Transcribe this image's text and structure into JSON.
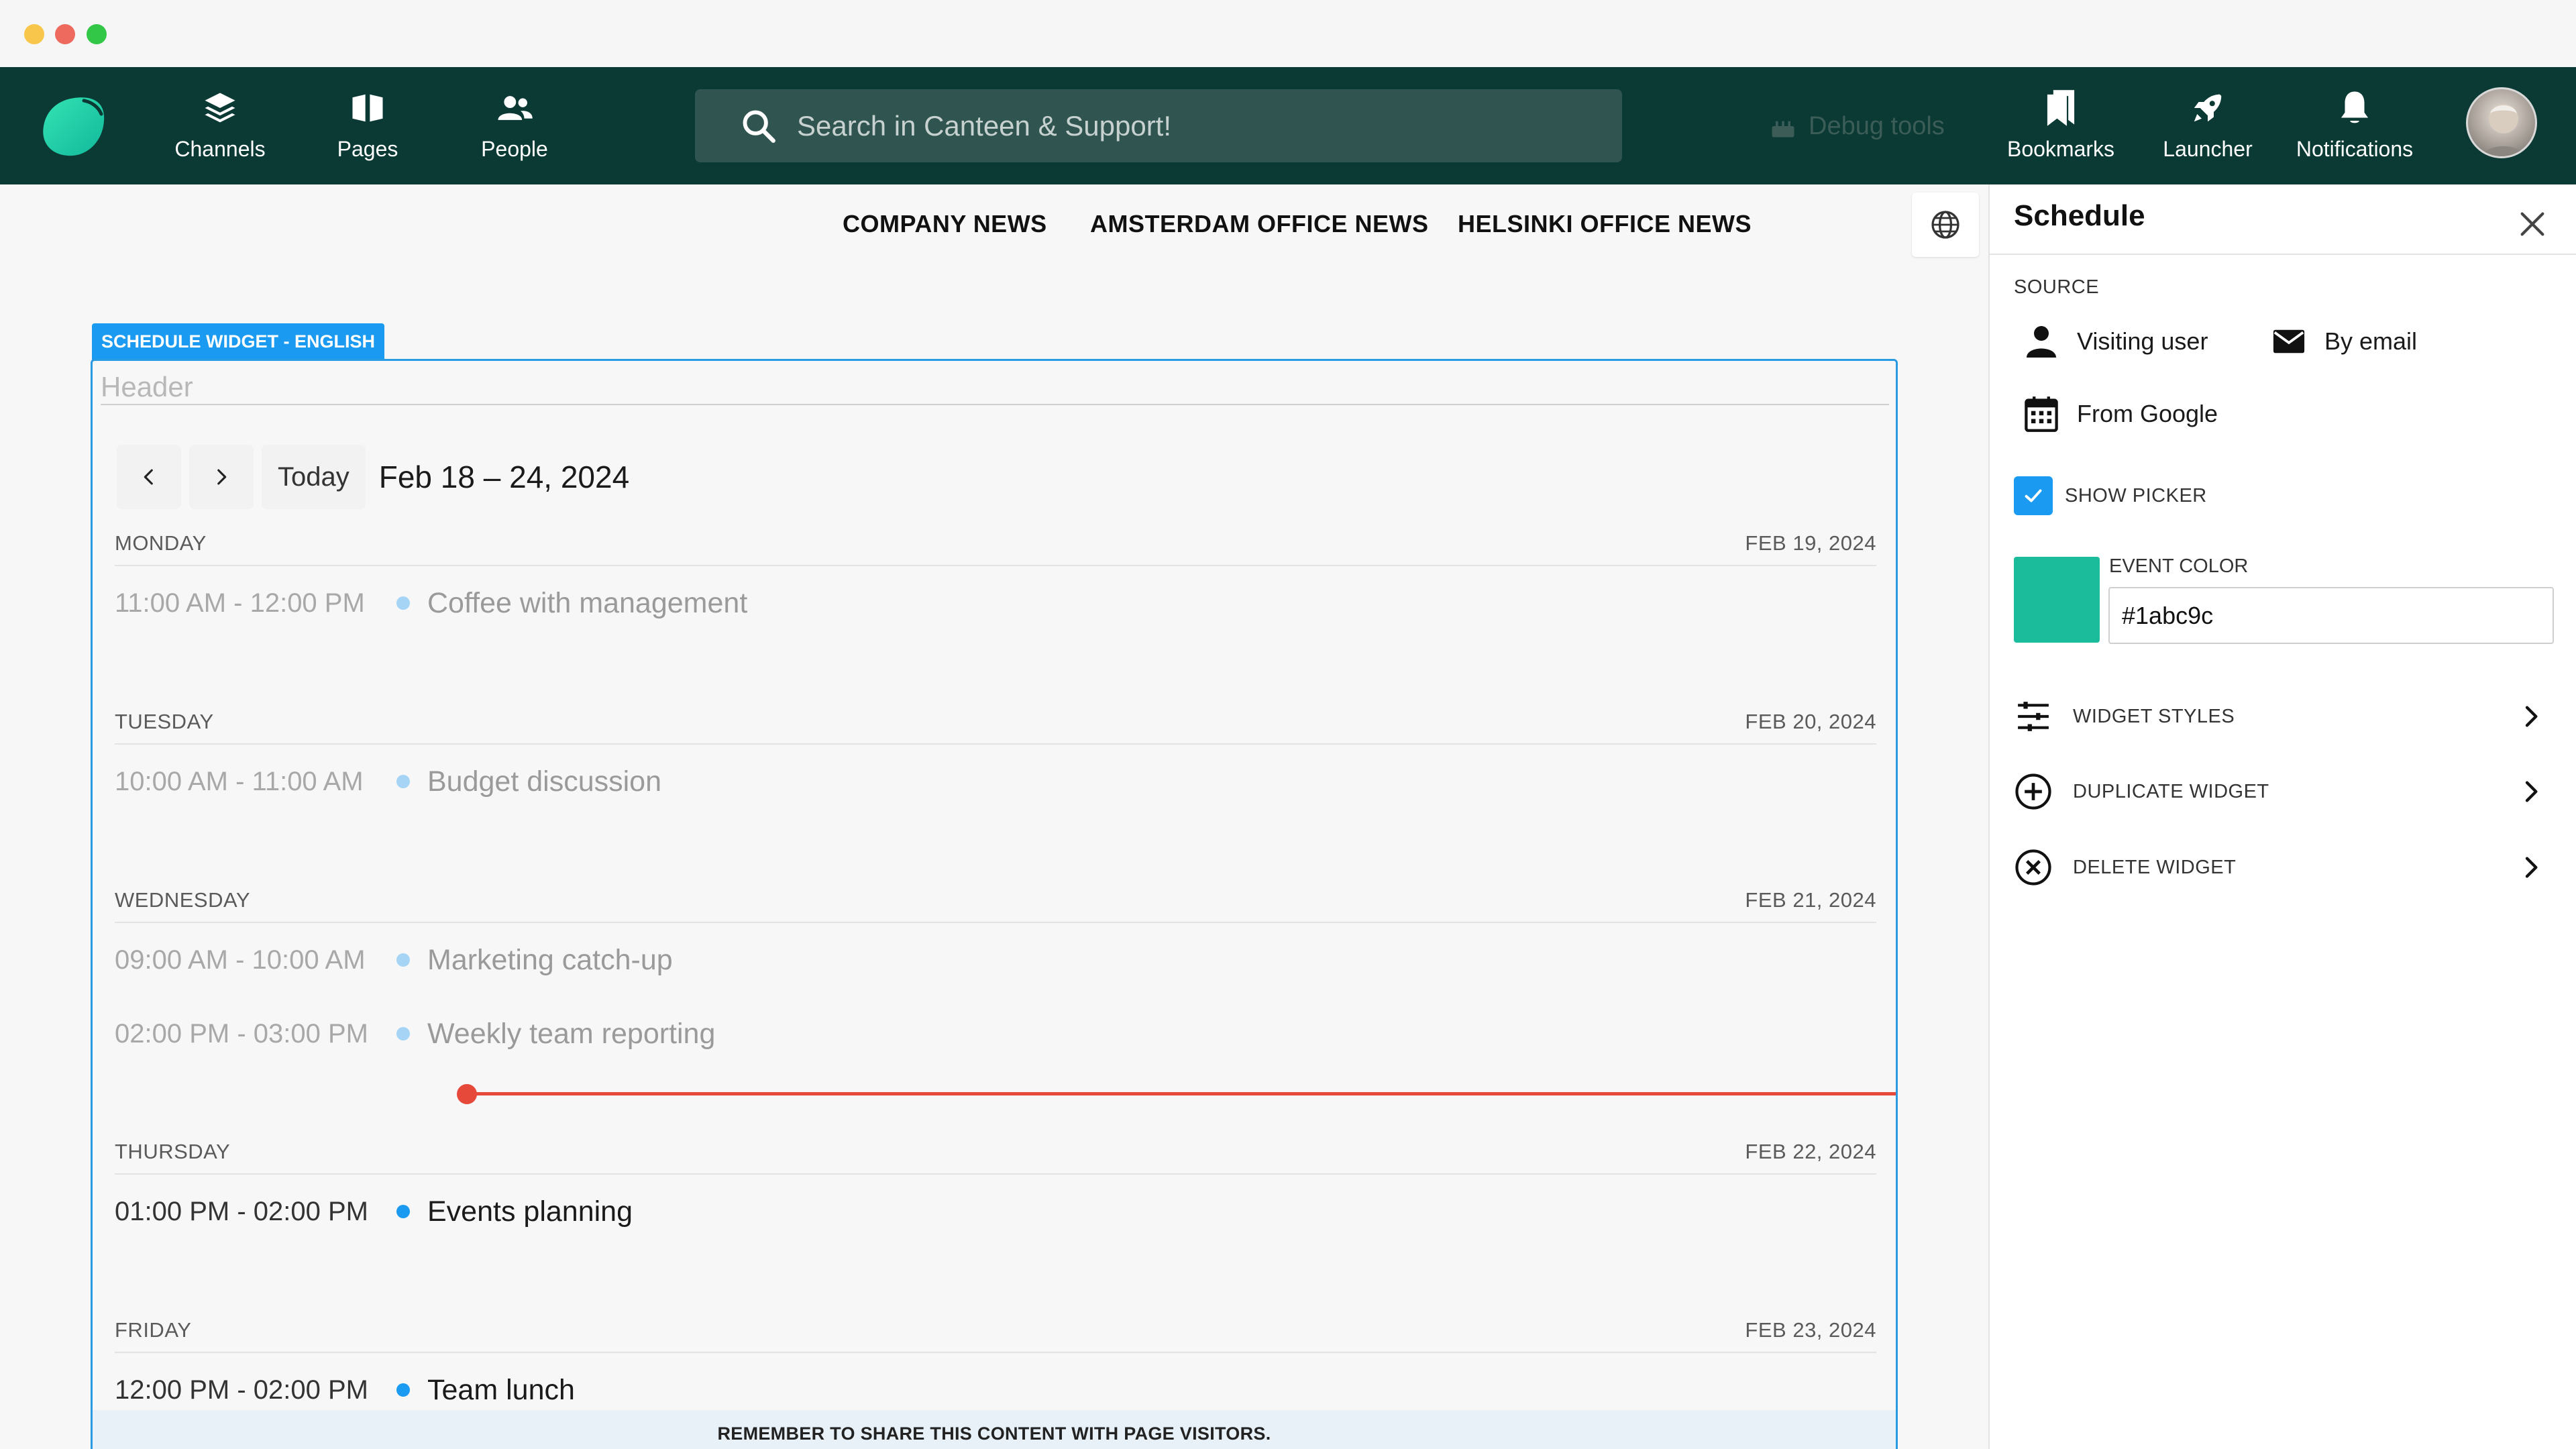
{
  "window": {
    "controls": [
      "minimize",
      "close",
      "maximize"
    ]
  },
  "nav": {
    "items": [
      {
        "label": "Channels",
        "icon": "layers-icon"
      },
      {
        "label": "Pages",
        "icon": "book-icon"
      },
      {
        "label": "People",
        "icon": "people-icon"
      }
    ],
    "search_placeholder": "Search in Canteen & Support!",
    "debug_label": "Debug tools",
    "right_items": [
      {
        "label": "Bookmarks",
        "icon": "bookmark-icon"
      },
      {
        "label": "Launcher",
        "icon": "rocket-icon"
      },
      {
        "label": "Notifications",
        "icon": "bell-icon"
      }
    ]
  },
  "tabs": [
    "COMPANY NEWS",
    "AMSTERDAM OFFICE NEWS",
    "HELSINKI OFFICE NEWS"
  ],
  "widget": {
    "tag": "SCHEDULE WIDGET - ENGLISH",
    "header_placeholder": "Header",
    "today_label": "Today",
    "range": "Feb 18 – 24, 2024",
    "days": [
      {
        "name": "MONDAY",
        "date": "FEB 19, 2024",
        "events": [
          {
            "time": "11:00 AM - 12:00 PM",
            "title": "Coffee with management",
            "past": true
          }
        ]
      },
      {
        "name": "TUESDAY",
        "date": "FEB 20, 2024",
        "events": [
          {
            "time": "10:00 AM - 11:00 AM",
            "title": "Budget discussion",
            "past": true
          }
        ]
      },
      {
        "name": "WEDNESDAY",
        "date": "FEB 21, 2024",
        "events": [
          {
            "time": "09:00 AM - 10:00 AM",
            "title": "Marketing catch-up",
            "past": true
          },
          {
            "time": "02:00 PM - 03:00 PM",
            "title": "Weekly team reporting",
            "past": true
          }
        ]
      },
      {
        "name": "THURSDAY",
        "date": "FEB 22, 2024",
        "events": [
          {
            "time": "01:00 PM - 02:00 PM",
            "title": "Events planning",
            "past": false
          }
        ]
      },
      {
        "name": "FRIDAY",
        "date": "FEB 23, 2024",
        "events": [
          {
            "time": "12:00 PM - 02:00 PM",
            "title": "Team lunch",
            "past": false
          }
        ]
      }
    ],
    "share_banner": "REMEMBER TO SHARE THIS CONTENT WITH PAGE VISITORS."
  },
  "panel": {
    "title": "Schedule",
    "source_label": "SOURCE",
    "sources": [
      "Visiting user",
      "By email",
      "From Google"
    ],
    "show_picker_label": "SHOW PICKER",
    "show_picker_checked": true,
    "event_color_label": "EVENT COLOR",
    "event_color_value": "#1abc9c",
    "actions": [
      "WIDGET STYLES",
      "DUPLICATE WIDGET",
      "DELETE WIDGET"
    ]
  },
  "colors": {
    "nav_bg": "#0b3a34",
    "accent": "#1a9af0",
    "brand": "#1abc9c",
    "now_line": "#e6483a"
  }
}
